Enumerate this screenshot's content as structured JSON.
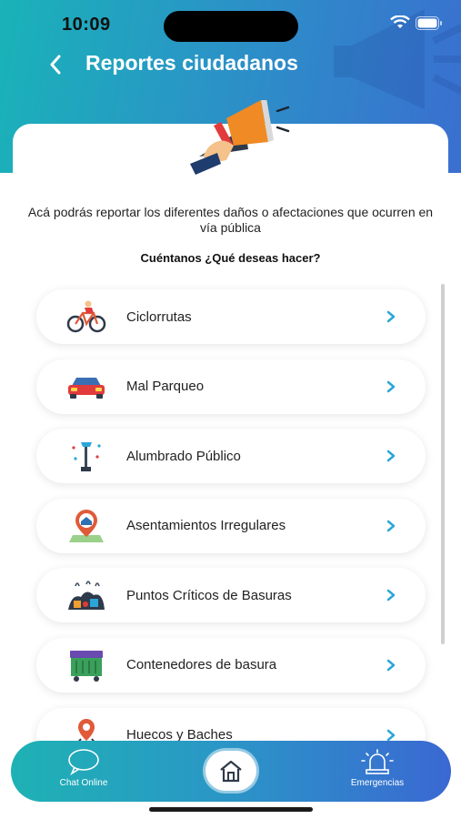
{
  "status_bar": {
    "time": "10:09"
  },
  "header": {
    "title": "Reportes ciudadanos",
    "back_icon": "chevron-left-icon"
  },
  "intro": {
    "text": "Acá podrás reportar los diferentes daños o afectaciones que ocurren en vía pública",
    "question": "Cuéntanos ¿Qué deseas hacer?"
  },
  "menu": {
    "items": [
      {
        "label": "Ciclorrutas",
        "icon": "bicycle-icon"
      },
      {
        "label": "Mal Parqueo",
        "icon": "car-icon"
      },
      {
        "label": "Alumbrado Público",
        "icon": "streetlight-icon"
      },
      {
        "label": "Asentamientos Irregulares",
        "icon": "house-pin-icon"
      },
      {
        "label": "Puntos Críticos de Basuras",
        "icon": "garbage-pile-icon"
      },
      {
        "label": "Contenedores de basura",
        "icon": "dumpster-icon"
      },
      {
        "label": "Huecos y Baches",
        "icon": "pothole-pin-icon"
      }
    ]
  },
  "bottom_nav": {
    "chat_label": "Chat Online",
    "emergencies_label": "Emergencias"
  },
  "colors": {
    "header_start": "#19b3b8",
    "header_end": "#3a6fd0",
    "chevron": "#2aa6d8"
  }
}
